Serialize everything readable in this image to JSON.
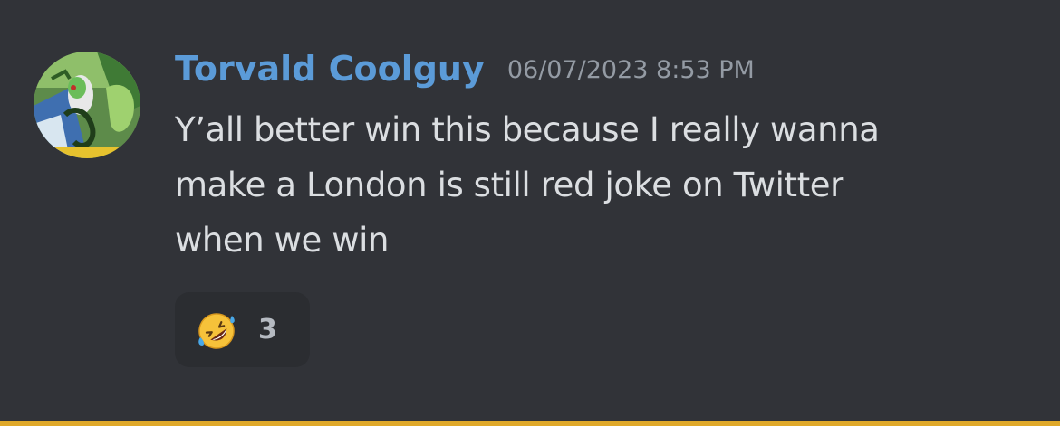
{
  "message": {
    "author": "Torvald Coolguy",
    "timestamp": "06/07/2023 8:53 PM",
    "lines": [
      "Y’all better win this because I really wanna",
      "make a London is still red joke on Twitter",
      "when we win"
    ],
    "author_color": "#5b9bd8",
    "avatar_icon": "avatar"
  },
  "reactions": [
    {
      "emoji_name": "rolling-on-the-floor-laughing-icon",
      "count": "3"
    }
  ],
  "colors": {
    "background": "#313338",
    "reaction_background": "#2b2d31",
    "text": "#dbdee1",
    "timestamp": "#949ba4"
  }
}
